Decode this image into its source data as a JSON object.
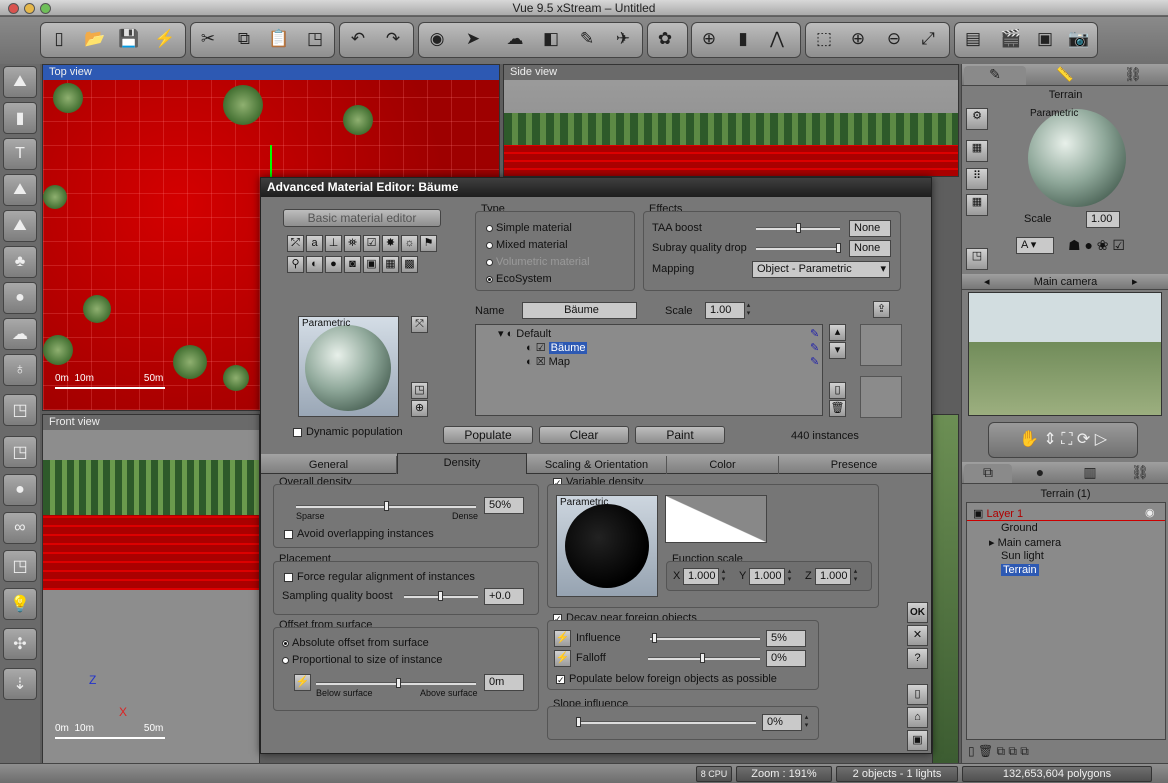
{
  "window": {
    "title": "Vue 9.5 xStream – Untitled"
  },
  "toolbar": {
    "icons": [
      "new-file-icon",
      "open-folder-icon",
      "save-icon",
      "lightning-icon",
      "scissors-icon",
      "copy-icon",
      "paste-icon",
      "cube-icon",
      "undo-icon",
      "redo-icon",
      "select-icon",
      "pointer-icon",
      "cloud-icon",
      "render-box-icon",
      "brush-icon",
      "spray-icon",
      "color-balls-icon",
      "globe-icon",
      "bars-icon",
      "compass-icon",
      "marquee-icon",
      "zoom-in-icon",
      "zoom-out-icon",
      "fit-icon",
      "film-icon",
      "clapper-icon",
      "frame-icon",
      "camera-icon"
    ]
  },
  "viewports": {
    "top": {
      "label": "Top view",
      "scale_labels": [
        "0m",
        "10m",
        "50m"
      ]
    },
    "side": {
      "label": "Side view"
    },
    "front": {
      "label": "Front view",
      "scale_labels": [
        "0m",
        "10m",
        "50m"
      ],
      "axes": [
        "Z",
        "X"
      ]
    }
  },
  "right_panel": {
    "material_title": "Terrain",
    "preview_label": "Parametric",
    "scale_label": "Scale",
    "scale_value": "1.00",
    "layer_select": "A",
    "camera_title": "Main camera",
    "objects_title": "Terrain (1)",
    "tree": [
      {
        "label": "Layer 1",
        "level": 0
      },
      {
        "label": "Ground",
        "level": 1
      },
      {
        "label": "Main camera",
        "level": 1
      },
      {
        "label": "Sun light",
        "level": 1
      },
      {
        "label": "Terrain",
        "level": 1
      }
    ]
  },
  "dialog": {
    "title": "Advanced Material Editor: Bäume",
    "basic_button": "Basic material editor",
    "type": {
      "title": "Type",
      "options": [
        "Simple material",
        "Mixed material",
        "Volumetric material",
        "EcoSystem"
      ],
      "selected": "EcoSystem"
    },
    "effects": {
      "title": "Effects",
      "taa_label": "TAA boost",
      "taa_value": "None",
      "subray_label": "Subray quality drop",
      "subray_value": "None",
      "mapping_label": "Mapping",
      "mapping_value": "Object - Parametric"
    },
    "preview_label": "Parametric",
    "dynamic_label": "Dynamic population",
    "name_label": "Name",
    "name_value": "Bäume",
    "scale_label": "Scale",
    "scale_value": "1.00",
    "tree": [
      {
        "label": "Default",
        "level": 0
      },
      {
        "label": "Bäume",
        "level": 1
      },
      {
        "label": "Map",
        "level": 1
      }
    ],
    "populate": "Populate",
    "clear": "Clear",
    "paint": "Paint",
    "instances": "440 instances",
    "tabs": [
      "General",
      "Density",
      "Scaling & Orientation",
      "Color",
      "Presence"
    ],
    "active_tab": "Density",
    "overall": {
      "title": "Overall density",
      "value": "50%",
      "level": 0.5,
      "sparse": "Sparse",
      "dense": "Dense",
      "avoid": "Avoid overlapping instances"
    },
    "placement": {
      "title": "Placement",
      "force": "Force regular alignment of instances",
      "sampling": "Sampling quality boost",
      "sampling_value": "+0.0"
    },
    "offset": {
      "title": "Offset from surface",
      "abs": "Absolute offset from surface",
      "prop": "Proportional to size of instance",
      "below": "Below surface",
      "above": "Above surface",
      "value": "0m"
    },
    "variable": {
      "title": "Variable density",
      "preview_label": "Parametric",
      "fscale_title": "Function scale",
      "x": "1.000",
      "y": "1.000",
      "z": "1.000",
      "x_label": "X",
      "y_label": "Y",
      "z_label": "Z"
    },
    "decay": {
      "title": "Decay near foreign objects",
      "influence": "Influence",
      "influence_value": "5%",
      "falloff": "Falloff",
      "falloff_value": "0%",
      "populate_below": "Populate below foreign objects as possible"
    },
    "slope": {
      "title": "Slope influence",
      "value": "0%"
    },
    "side_buttons": {
      "ok": "OK",
      "cancel": "✕",
      "help": "?"
    }
  },
  "status": {
    "cpu": "8 CPU",
    "zoom": "Zoom : 191%",
    "objects": "2 objects - 1 lights",
    "polygons": "132,653,604 polygons"
  }
}
